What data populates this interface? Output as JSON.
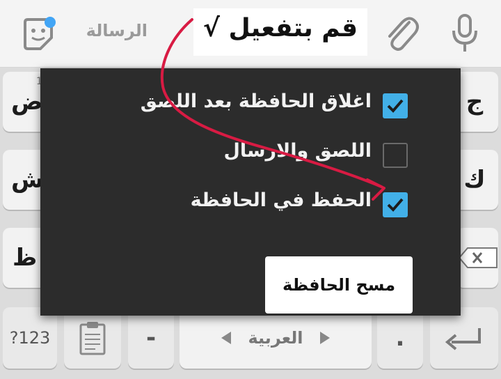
{
  "topbar": {
    "placeholder": "الرسالة",
    "icons": [
      "microphone-icon",
      "paperclip-icon",
      "sticker-icon"
    ]
  },
  "annotation": {
    "text": "قم بتفعيل √",
    "arrow_color": "#d81b43"
  },
  "dialog": {
    "options": [
      {
        "label": "اغلاق الحافظة بعد اللصق",
        "checked": true
      },
      {
        "label": "اللصق والارسال",
        "checked": false
      },
      {
        "label": "الحفظ في الحافظة",
        "checked": true
      }
    ],
    "clear_button": "مسح الحافظة",
    "checkbox_color": "#42b0e8"
  },
  "keyboard": {
    "row1_right": "ج",
    "row1_left": "ض",
    "row1_left_hint": "1",
    "row2_right": "ك",
    "row2_left": "ش",
    "row3_left": "ظ",
    "num_key": "?123",
    "dash_key": "-",
    "space_label": "العربية",
    "period_key": ".",
    "period_hint": "'"
  }
}
